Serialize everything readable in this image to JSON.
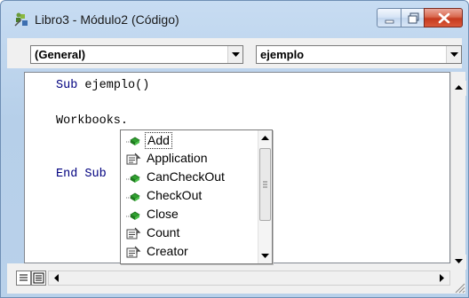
{
  "window": {
    "title": "Libro3 - Módulo2 (Código)",
    "icon": "vba-module-icon"
  },
  "toolbar": {
    "object_combo": {
      "value": "(General)"
    },
    "procedure_combo": {
      "value": "ejemplo"
    }
  },
  "code": {
    "lines": [
      {
        "keyword": "Sub",
        "rest": " ejemplo()"
      },
      {
        "keyword": "",
        "rest": "Workbooks."
      },
      {
        "keyword": "End Sub",
        "rest": ""
      }
    ]
  },
  "intellisense": {
    "items": [
      {
        "label": "Add",
        "icon": "method-icon",
        "selected": true
      },
      {
        "label": "Application",
        "icon": "property-icon"
      },
      {
        "label": "CanCheckOut",
        "icon": "method-icon"
      },
      {
        "label": "CheckOut",
        "icon": "method-icon"
      },
      {
        "label": "Close",
        "icon": "method-icon"
      },
      {
        "label": "Count",
        "icon": "property-icon"
      },
      {
        "label": "Creator",
        "icon": "property-icon"
      }
    ]
  },
  "colors": {
    "keyword": "#00007f",
    "title_bar": "#b9d1ea",
    "close_button": "#c63a1f"
  }
}
